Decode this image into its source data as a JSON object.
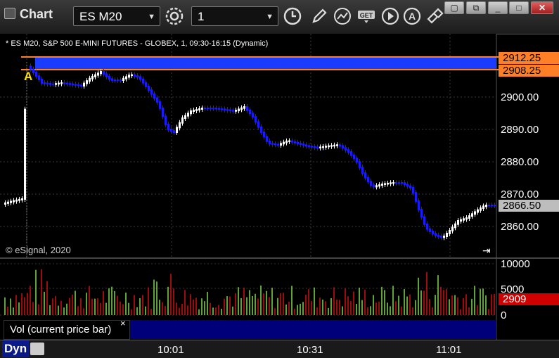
{
  "window": {
    "title": "Chart",
    "symbol": "ES M20",
    "interval": "1"
  },
  "chart": {
    "header_text": "* ES M20, S&P 500 E-MINI FUTURES - GLOBEX, 1, 09:30-16:15 (Dynamic)",
    "copyright": "© eSignal, 2020",
    "marker_label": "A",
    "price_axis": [
      "2900.00",
      "2890.00",
      "2880.00",
      "2870.00",
      "2860.00"
    ],
    "price_tags": {
      "upper": "2912.25",
      "lower": "2908.25",
      "last": "2866.50"
    },
    "colors": {
      "up_candle": "#ffffff",
      "down_candle": "#1a1aff",
      "band": "#1a3cff",
      "band_border": "#ff7f27",
      "last_tag": "#bdbdbd",
      "vol_up": "#7fd84a",
      "vol_down": "#d01010",
      "vol_tag": "#d00000"
    }
  },
  "volume": {
    "label": "Vol (current price bar)",
    "close_glyph": "×",
    "axis": [
      "10000",
      "5000",
      "0"
    ],
    "current_tag": "2909"
  },
  "time_axis": [
    "10:01",
    "10:31",
    "11:01"
  ],
  "footer": {
    "dyn_label": "Dyn"
  },
  "icons": [
    "settings-icon",
    "clock-icon",
    "pencil-icon",
    "line-study-icon",
    "get-icon",
    "play-icon",
    "alert-icon",
    "link-icon"
  ]
}
